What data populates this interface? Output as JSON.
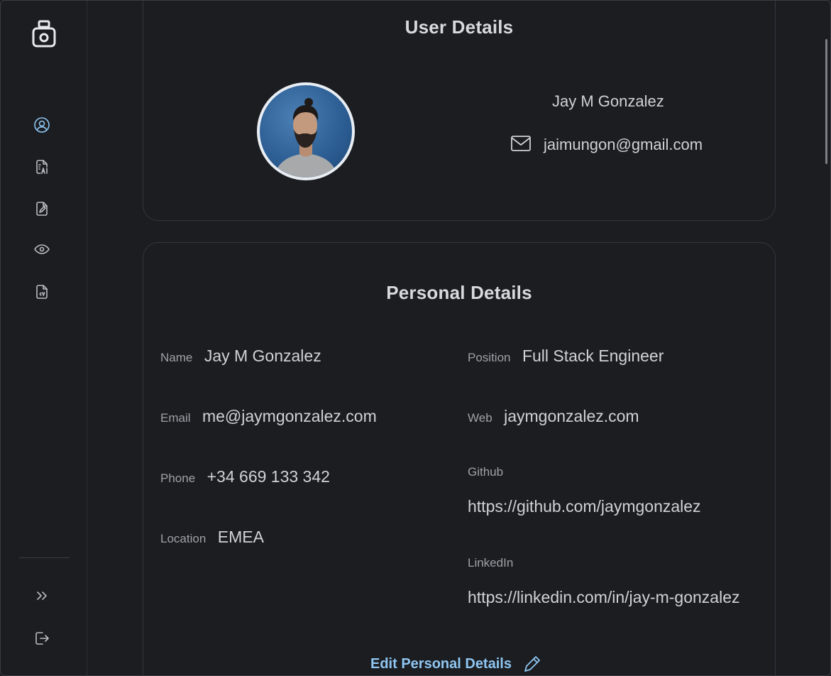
{
  "sidebar": {
    "logo": "robot-logo",
    "items": [
      {
        "icon": "user-circle-icon",
        "active": true
      },
      {
        "icon": "ai-document-icon",
        "active": false
      },
      {
        "icon": "edit-document-icon",
        "active": false
      },
      {
        "icon": "eye-icon",
        "active": false
      },
      {
        "icon": "cv-document-icon",
        "active": false
      }
    ],
    "bottom": [
      {
        "icon": "chevrons-right-icon"
      },
      {
        "icon": "logout-icon"
      }
    ]
  },
  "user_details": {
    "title": "User Details",
    "name": "Jay M Gonzalez",
    "email": "jaimungon@gmail.com"
  },
  "personal_details": {
    "title": "Personal Details",
    "name_label": "Name",
    "name_value": "Jay M Gonzalez",
    "email_label": "Email",
    "email_value": "me@jaymgonzalez.com",
    "phone_label": "Phone",
    "phone_value": "+34 669 133 342",
    "location_label": "Location",
    "location_value": "EMEA",
    "position_label": "Position",
    "position_value": "Full Stack Engineer",
    "web_label": "Web",
    "web_value": "jaymgonzalez.com",
    "github_label": "Github",
    "github_value": "https://github.com/jaymgonzalez",
    "linkedin_label": "LinkedIn",
    "linkedin_value": "https://linkedin.com/in/jay-m-gonzalez",
    "edit_label": "Edit Personal Details"
  },
  "colors": {
    "accent": "#8fc6f2",
    "background": "#1b1d21",
    "border": "#34373e"
  }
}
